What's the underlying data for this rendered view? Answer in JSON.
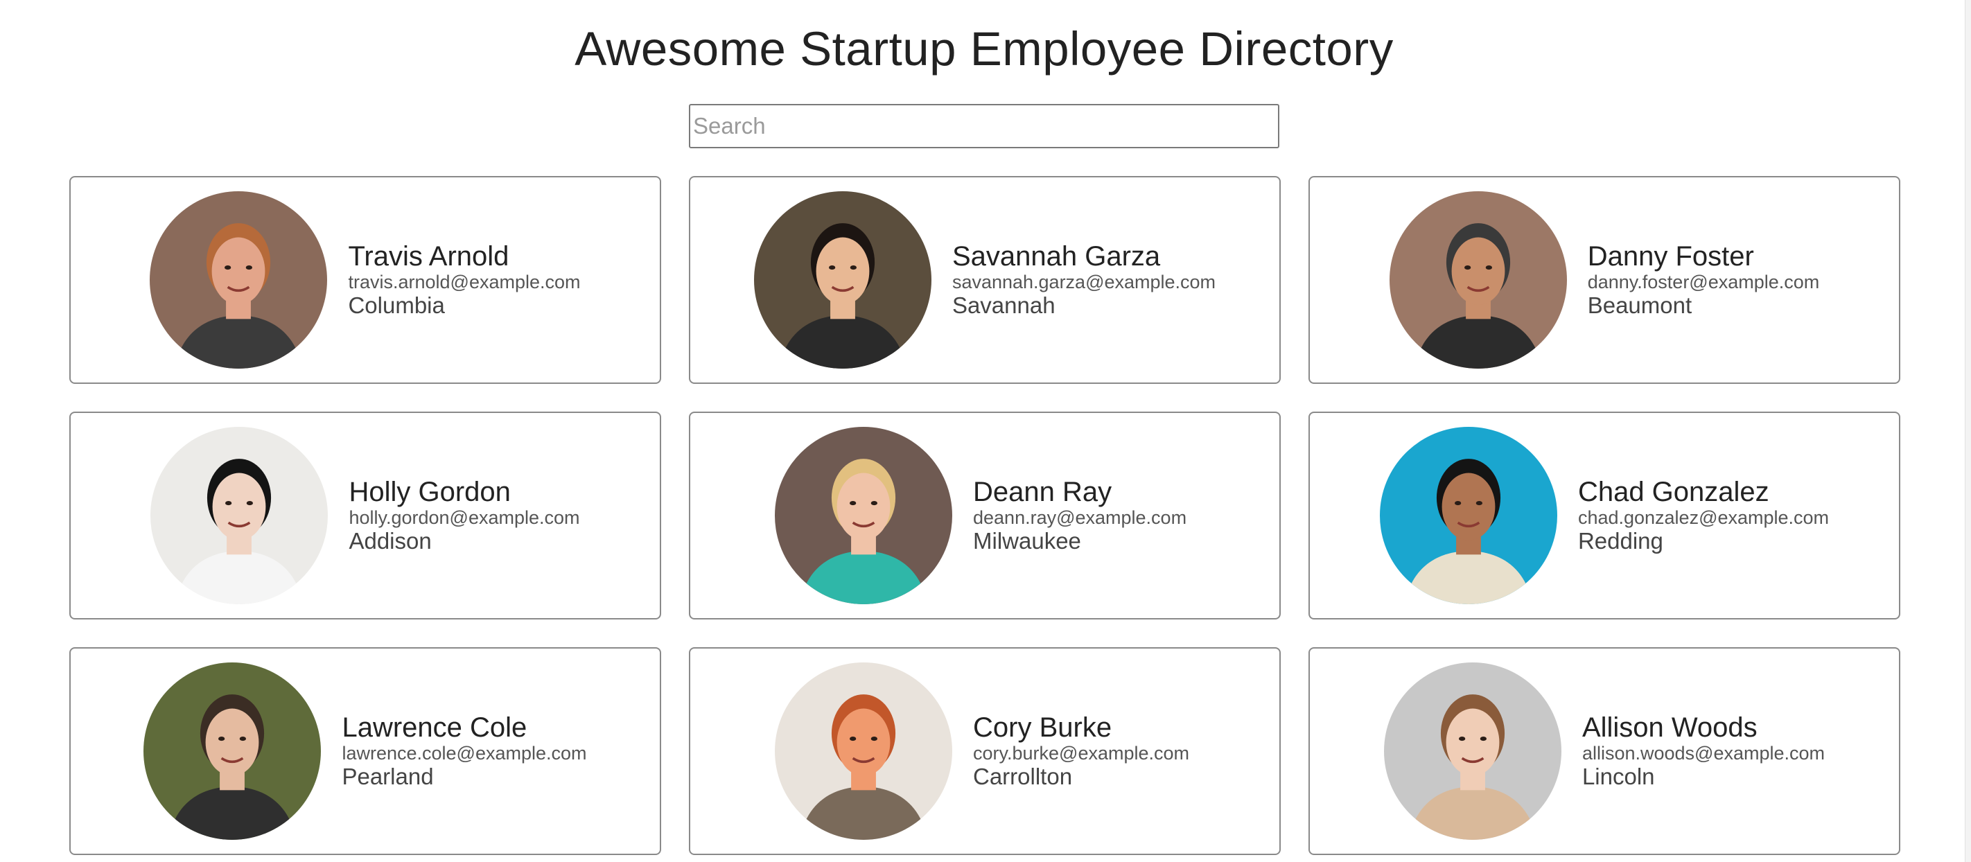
{
  "header": {
    "title": "Awesome Startup Employee Directory"
  },
  "search": {
    "placeholder": "Search",
    "value": ""
  },
  "employees": [
    {
      "name": "Travis Arnold",
      "email": "travis.arnold@example.com",
      "city": "Columbia",
      "bg": "#8a6a5a",
      "skin": "#e3a58a",
      "hair": "#b66a3a",
      "shirt": "#3b3b3b"
    },
    {
      "name": "Savannah Garza",
      "email": "savannah.garza@example.com",
      "city": "Savannah",
      "bg": "#5b4e3d",
      "skin": "#e8b894",
      "hair": "#1c1512",
      "shirt": "#2a2a2a"
    },
    {
      "name": "Danny Foster",
      "email": "danny.foster@example.com",
      "city": "Beaumont",
      "bg": "#9c7866",
      "skin": "#c98f6b",
      "hair": "#3a3a3a",
      "shirt": "#2c2c2c"
    },
    {
      "name": "Holly Gordon",
      "email": "holly.gordon@example.com",
      "city": "Addison",
      "bg": "#ecebe8",
      "skin": "#f0d3c2",
      "hair": "#141414",
      "shirt": "#f5f5f5"
    },
    {
      "name": "Deann Ray",
      "email": "deann.ray@example.com",
      "city": "Milwaukee",
      "bg": "#6f5a52",
      "skin": "#f0c3a8",
      "hair": "#e2c07f",
      "shirt": "#2fb7a8"
    },
    {
      "name": "Chad Gonzalez",
      "email": "chad.gonzalez@example.com",
      "city": "Redding",
      "bg": "#1aa6cf",
      "skin": "#b07552",
      "hair": "#141414",
      "shirt": "#e8e0cc"
    },
    {
      "name": "Lawrence Cole",
      "email": "lawrence.cole@example.com",
      "city": "Pearland",
      "bg": "#5f6b3a",
      "skin": "#e5bba0",
      "hair": "#3b2d24",
      "shirt": "#2f2f2f"
    },
    {
      "name": "Cory Burke",
      "email": "cory.burke@example.com",
      "city": "Carrollton",
      "bg": "#e9e3dc",
      "skin": "#f09a6e",
      "hair": "#c2572a",
      "shirt": "#7a6a5a"
    },
    {
      "name": "Allison Woods",
      "email": "allison.woods@example.com",
      "city": "Lincoln",
      "bg": "#c8c8c8",
      "skin": "#f0cdb6",
      "hair": "#8a5b3a",
      "shirt": "#d9b99a"
    }
  ]
}
